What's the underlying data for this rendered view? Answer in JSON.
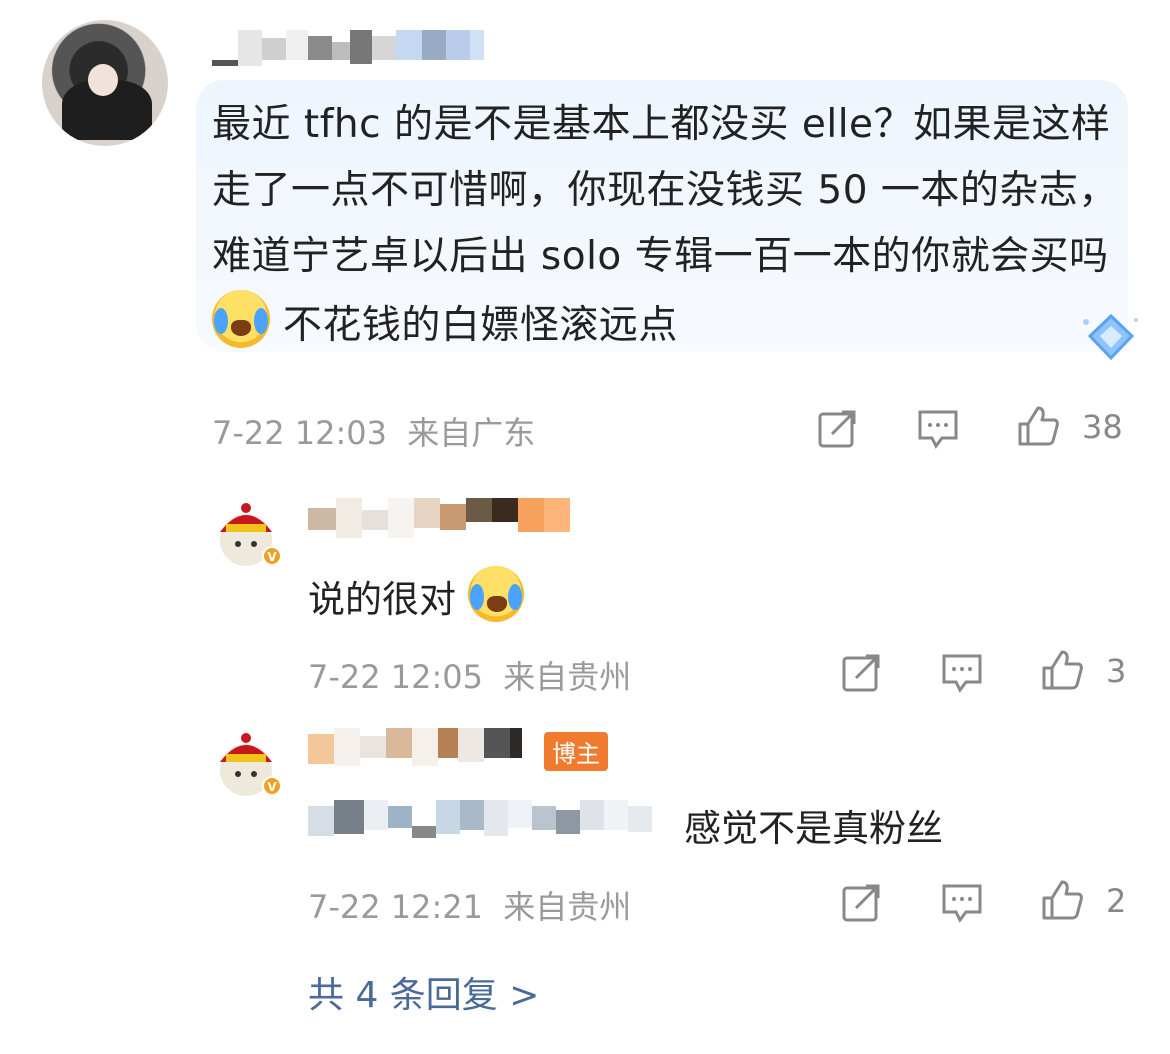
{
  "main_comment": {
    "text": "最近 tfhc 的是不是基本上都没买 elle？如果是这样走了一点不可惜啊，你现在没钱买 50 一本的杂志，难道宁艺卓以后出 solo 专辑一百一本的你就会买吗",
    "text_tail": "不花钱的白嫖怪滚远点",
    "time": "7-22 12:03",
    "location": "来自广东",
    "likes": "38"
  },
  "replies": [
    {
      "text": "说的很对",
      "time": "7-22 12:05",
      "location": "来自贵州",
      "likes": "3"
    },
    {
      "badge": "博主",
      "text_tail": "感觉不是真粉丝",
      "time": "7-22 12:21",
      "location": "来自贵州",
      "likes": "2"
    }
  ],
  "more_replies_label": "共 4 条回复 >",
  "icons": [
    "repost-icon",
    "comment-icon",
    "like-icon",
    "gem-badge-icon",
    "laughing-crying-emoji-icon",
    "verified-v-icon"
  ],
  "colors": {
    "bubble_bg": "#eef5fd",
    "meta_text": "#9a9a9a",
    "link": "#4a6a9a",
    "badge": "#f07a2e",
    "verified": "#f0a020"
  }
}
